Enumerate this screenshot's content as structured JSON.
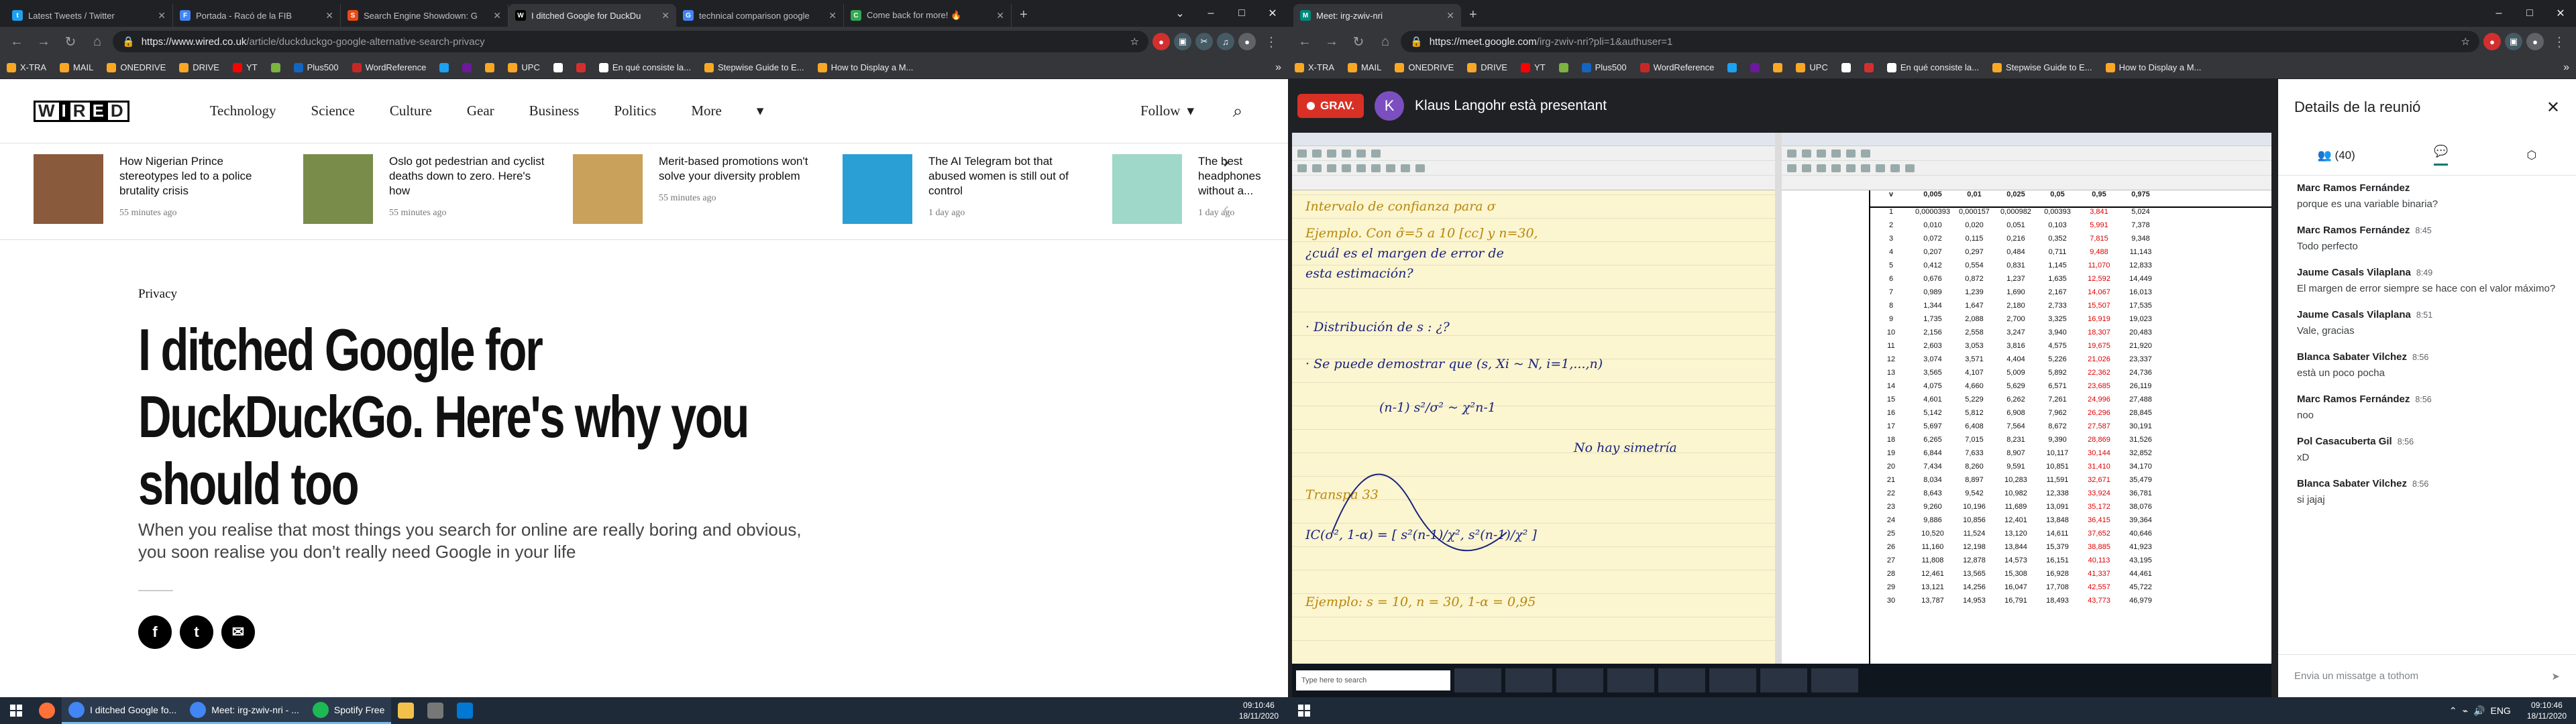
{
  "left": {
    "tabs": [
      {
        "title": "Latest Tweets / Twitter",
        "color": "#1da1f2",
        "glyph": "t",
        "active": false
      },
      {
        "title": "Portada - Racó de la FIB",
        "color": "#4285f4",
        "glyph": "F",
        "active": false
      },
      {
        "title": "Search Engine Showdown: G",
        "color": "#e64a19",
        "glyph": "S",
        "active": false
      },
      {
        "title": "I ditched Google for DuckDu",
        "color": "#000000",
        "glyph": "W",
        "active": true
      },
      {
        "title": "technical comparison google",
        "color": "#4285f4",
        "glyph": "G",
        "active": false
      },
      {
        "title": "Come back for more! 🔥",
        "color": "#34a853",
        "glyph": "C",
        "active": false
      }
    ],
    "url": {
      "host": "https://www.wired.co.uk",
      "path": "/article/duckduckgo-google-alternative-search-privacy"
    },
    "bookmarks": [
      {
        "label": "X-TRA",
        "color": "#f9a825"
      },
      {
        "label": "MAIL",
        "color": "#f9a825"
      },
      {
        "label": "ONEDRIVE",
        "color": "#f9a825"
      },
      {
        "label": "DRIVE",
        "color": "#f9a825"
      },
      {
        "label": "YT",
        "color": "#ff0000"
      },
      {
        "label": "",
        "color": "#7cb342"
      },
      {
        "label": "Plus500",
        "color": "#1565c0"
      },
      {
        "label": "WordReference",
        "color": "#c62828"
      },
      {
        "label": "",
        "color": "#1da1f2"
      },
      {
        "label": "",
        "color": "#6a1b9a"
      },
      {
        "label": "",
        "color": "#f9a825"
      },
      {
        "label": "UPC",
        "color": "#f9a825"
      },
      {
        "label": "",
        "color": "#ffffff"
      },
      {
        "label": "",
        "color": "#d32f2f"
      },
      {
        "label": "En qué consiste la...",
        "color": "#ffffff"
      },
      {
        "label": "Stepwise Guide to E...",
        "color": "#f9a825"
      },
      {
        "label": "How to Display a M...",
        "color": "#f9a825"
      }
    ],
    "wired": {
      "nav": [
        "Technology",
        "Science",
        "Culture",
        "Gear",
        "Business",
        "Politics",
        "More"
      ],
      "follow": "Follow",
      "cards": [
        {
          "title": "How Nigerian Prince stereotypes led to a police brutality crisis",
          "time": "55 minutes ago",
          "thumb": "#8a5a3c"
        },
        {
          "title": "Oslo got pedestrian and cyclist deaths down to zero. Here's how",
          "time": "55 minutes ago",
          "thumb": "#7a8c4a"
        },
        {
          "title": "Merit-based promotions won't solve your diversity problem",
          "time": "55 minutes ago",
          "thumb": "#c9a15a"
        },
        {
          "title": "The AI Telegram bot that abused women is still out of control",
          "time": "1 day ago",
          "thumb": "#2a9fd6"
        },
        {
          "title": "The best headphones without a...",
          "time": "1 day ago",
          "thumb": "#9fd8c8"
        }
      ],
      "rubric": "Privacy",
      "headline": "I ditched Google for DuckDuckGo. Here's why you should too",
      "dek": "When you realise that most things you search for online are really boring and obvious, you soon realise you don't really need Google in your life"
    },
    "taskbar": {
      "apps": [
        {
          "label": "I ditched Google fo...",
          "color": "#4285f4"
        },
        {
          "label": "Meet: irg-zwiv-nri - ...",
          "color": "#4285f4"
        },
        {
          "label": "Spotify Free",
          "color": "#1db954"
        }
      ],
      "time": "09:10:46",
      "date": "18/11/2020"
    }
  },
  "right": {
    "tabs": [
      {
        "title": "Meet: irg-zwiv-nri",
        "color": "#00897b",
        "glyph": "M",
        "active": true
      }
    ],
    "url": {
      "host": "https://meet.google.com",
      "path": "/irg-zwiv-nri?pli=1&authuser=1"
    },
    "meet": {
      "recording": "GRAV.",
      "presenter_initial": "K",
      "presenter_text": "Klaus Langohr està presentant",
      "panel_title": "Details de la reunió",
      "participants": "(40)",
      "messages": [
        {
          "author": "Marc Ramos Fernández",
          "time": "",
          "text": "porque es una variable binaria?"
        },
        {
          "author": "Marc Ramos Fernández",
          "time": "8:45",
          "text": "Todo perfecto"
        },
        {
          "author": "Jaume Casals Vilaplana",
          "time": "8:49",
          "text": "El margen de error siempre se hace con el valor máximo?"
        },
        {
          "author": "Jaume Casals Vilaplana",
          "time": "8:51",
          "text": "Vale, gracias"
        },
        {
          "author": "Blanca Sabater Vilchez",
          "time": "8:56",
          "text": "està un poco pocha"
        },
        {
          "author": "Marc Ramos Fernández",
          "time": "8:56",
          "text": "noo"
        },
        {
          "author": "Pol Casacuberta Gil",
          "time": "8:56",
          "text": "xD"
        },
        {
          "author": "Blanca Sabater Vilchez",
          "time": "8:56",
          "text": "si jajaj"
        }
      ],
      "compose_placeholder": "Envia un missatge a tothom",
      "shared_notes": [
        "Intervalo de confianza para σ",
        "Ejemplo. Con σ̂=5 a 10 [cc] y n=30,",
        "¿cuál es el margen de error de",
        "esta estimación?",
        "· Distribución de s : ¿?",
        "· Se puede demostrar que (s, Xi ~ N, i=1,...,n)",
        "(n-1) s²/σ² ~ χ²n-1",
        "No hay simetría",
        "Transpa 33",
        "IC(σ², 1-α) = [ s²(n-1)/χ², s²(n-1)/χ² ]",
        "Ejemplo: s = 10, n = 30, 1-α = 0,95"
      ],
      "table_header": [
        "v",
        "0,005",
        "0,01",
        "0,025",
        "0,05",
        "0,95",
        "0,975"
      ],
      "table_rows": [
        [
          "1",
          "0,0000393",
          "0,000157",
          "0,000982",
          "0,00393",
          "3,841",
          "5,024"
        ],
        [
          "2",
          "0,010",
          "0,020",
          "0,051",
          "0,103",
          "5,991",
          "7,378"
        ],
        [
          "3",
          "0,072",
          "0,115",
          "0,216",
          "0,352",
          "7,815",
          "9,348"
        ],
        [
          "4",
          "0,207",
          "0,297",
          "0,484",
          "0,711",
          "9,488",
          "11,143"
        ],
        [
          "5",
          "0,412",
          "0,554",
          "0,831",
          "1,145",
          "11,070",
          "12,833"
        ],
        [
          "6",
          "0,676",
          "0,872",
          "1,237",
          "1,635",
          "12,592",
          "14,449"
        ],
        [
          "7",
          "0,989",
          "1,239",
          "1,690",
          "2,167",
          "14,067",
          "16,013"
        ],
        [
          "8",
          "1,344",
          "1,647",
          "2,180",
          "2,733",
          "15,507",
          "17,535"
        ],
        [
          "9",
          "1,735",
          "2,088",
          "2,700",
          "3,325",
          "16,919",
          "19,023"
        ],
        [
          "10",
          "2,156",
          "2,558",
          "3,247",
          "3,940",
          "18,307",
          "20,483"
        ],
        [
          "11",
          "2,603",
          "3,053",
          "3,816",
          "4,575",
          "19,675",
          "21,920"
        ],
        [
          "12",
          "3,074",
          "3,571",
          "4,404",
          "5,226",
          "21,026",
          "23,337"
        ],
        [
          "13",
          "3,565",
          "4,107",
          "5,009",
          "5,892",
          "22,362",
          "24,736"
        ],
        [
          "14",
          "4,075",
          "4,660",
          "5,629",
          "6,571",
          "23,685",
          "26,119"
        ],
        [
          "15",
          "4,601",
          "5,229",
          "6,262",
          "7,261",
          "24,996",
          "27,488"
        ],
        [
          "16",
          "5,142",
          "5,812",
          "6,908",
          "7,962",
          "26,296",
          "28,845"
        ],
        [
          "17",
          "5,697",
          "6,408",
          "7,564",
          "8,672",
          "27,587",
          "30,191"
        ],
        [
          "18",
          "6,265",
          "7,015",
          "8,231",
          "9,390",
          "28,869",
          "31,526"
        ],
        [
          "19",
          "6,844",
          "7,633",
          "8,907",
          "10,117",
          "30,144",
          "32,852"
        ],
        [
          "20",
          "7,434",
          "8,260",
          "9,591",
          "10,851",
          "31,410",
          "34,170"
        ],
        [
          "21",
          "8,034",
          "8,897",
          "10,283",
          "11,591",
          "32,671",
          "35,479"
        ],
        [
          "22",
          "8,643",
          "9,542",
          "10,982",
          "12,338",
          "33,924",
          "36,781"
        ],
        [
          "23",
          "9,260",
          "10,196",
          "11,689",
          "13,091",
          "35,172",
          "38,076"
        ],
        [
          "24",
          "9,886",
          "10,856",
          "12,401",
          "13,848",
          "36,415",
          "39,364"
        ],
        [
          "25",
          "10,520",
          "11,524",
          "13,120",
          "14,611",
          "37,652",
          "40,646"
        ],
        [
          "26",
          "11,160",
          "12,198",
          "13,844",
          "15,379",
          "38,885",
          "41,923"
        ],
        [
          "27",
          "11,808",
          "12,878",
          "14,573",
          "16,151",
          "40,113",
          "43,195"
        ],
        [
          "28",
          "12,461",
          "13,565",
          "15,308",
          "16,928",
          "41,337",
          "44,461"
        ],
        [
          "29",
          "13,121",
          "14,256",
          "16,047",
          "17,708",
          "42,557",
          "45,722"
        ],
        [
          "30",
          "13,787",
          "14,953",
          "16,791",
          "18,493",
          "43,773",
          "46,979"
        ]
      ],
      "inner_search": "Type here to search"
    },
    "taskbar": {
      "time": "09:10:46",
      "date": "18/11/2020",
      "lang": "ENG"
    }
  },
  "bookmark_more": "»"
}
